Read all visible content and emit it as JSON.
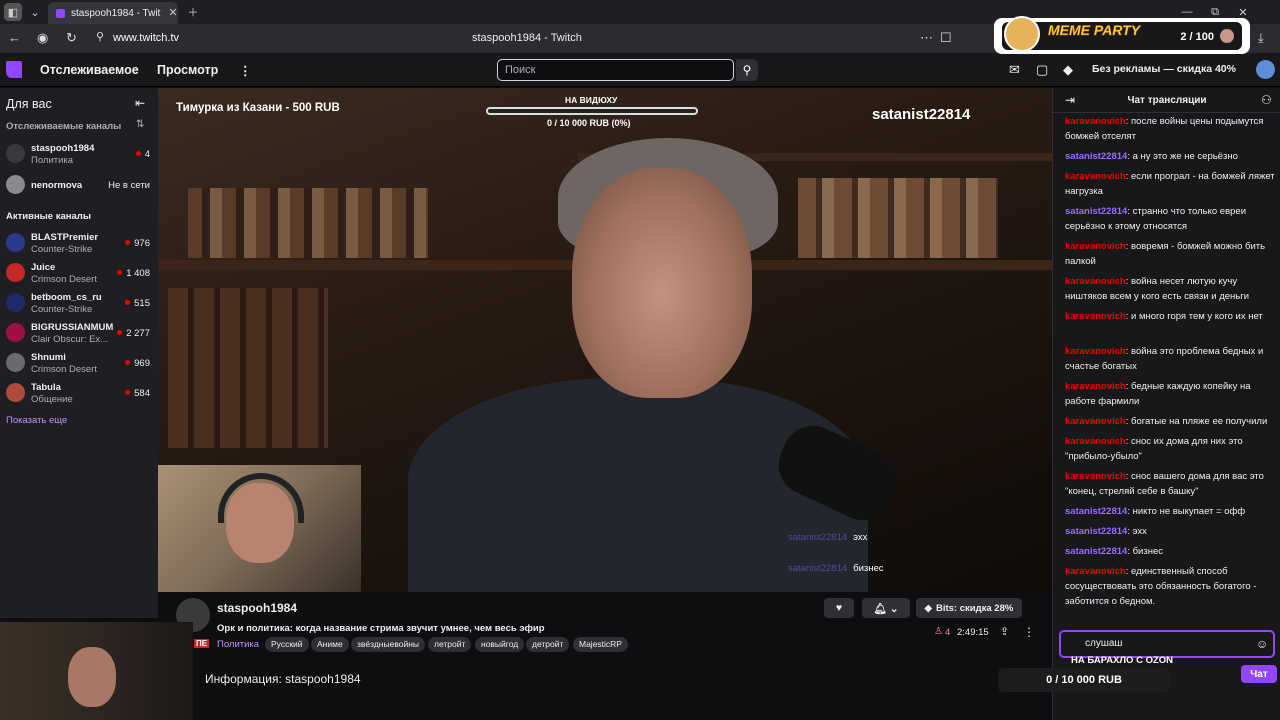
{
  "browser": {
    "tab_title": "staspooh1984 - Twit",
    "url": "www.twitch.tv",
    "page_title": "staspooh1984 - Twitch"
  },
  "topnav": {
    "following": "Отслеживаемое",
    "browse": "Просмотр",
    "search_placeholder": "Поиск",
    "promo": "Без рекламы — скидка 40%"
  },
  "sidebar": {
    "for_you": "Для вас",
    "followed_title": "Отслеживаемые каналы",
    "followed": [
      {
        "name": "staspooh1984",
        "game": "Политика",
        "viewers": "4",
        "color": "#3a3a3d"
      },
      {
        "name": "nenormova",
        "game": "",
        "status": "Не в сети",
        "color": "#8a8a8a"
      }
    ],
    "active_title": "Активные каналы",
    "active": [
      {
        "name": "BLASTPremier",
        "game": "Counter-Strike",
        "viewers": "976",
        "color": "#2b3a8a"
      },
      {
        "name": "Juice",
        "game": "Crimson Desert",
        "viewers": "1 408",
        "color": "#c62828"
      },
      {
        "name": "betboom_cs_ru",
        "game": "Counter-Strike",
        "viewers": "515",
        "color": "#1e2a6b"
      },
      {
        "name": "BIGRUSSIANMUM",
        "game": "Clair Obscur: Ex...",
        "viewers": "2 277",
        "color": "#a01040"
      },
      {
        "name": "Shnumi",
        "game": "Crimson Desert",
        "viewers": "969",
        "color": "#6b6b6b"
      },
      {
        "name": "Tabula",
        "game": "Общение",
        "viewers": "584",
        "color": "#b04a3a"
      }
    ],
    "show_more": "Показать еще"
  },
  "video": {
    "donation": "Тимурка из Казани - 500 RUB",
    "goal_title": "НА ВИДЮХУ",
    "goal_value": "0 / 10 000 RUB (0%)",
    "goal_progress": 0,
    "overlay_user": "satanist22814",
    "overlay_chat": [
      {
        "user": "satanist22814",
        "text": "эхх"
      },
      {
        "user": "satanist22814",
        "text": "бизнес"
      }
    ]
  },
  "stream": {
    "streamer": "staspooh1984",
    "title": "Орк и политика: когда название стрима звучит умнее, чем весь эфир",
    "badge": "ПЕ",
    "category": "Политика",
    "tags": [
      "Русский",
      "Аниме",
      "звёздныевойны",
      "летройт",
      "новыйгод",
      "детройт",
      "MajesticRP"
    ],
    "bits": "Bits: скидка 28%",
    "viewers": "4",
    "uptime": "2:49:15",
    "about": "Информация: staspooh1984"
  },
  "chat": {
    "title": "Чат трансляции",
    "messages": [
      {
        "user": "karavanovich",
        "text": "после войны цены подымутся бомжей отселят",
        "c": "u1"
      },
      {
        "user": "satanist22814",
        "text": "а ну это же не серьёзно",
        "c": "u2"
      },
      {
        "user": "karavanovich",
        "text": "если програл - на бомжей ляжет нагрузка",
        "c": "u1"
      },
      {
        "user": "satanist22814",
        "text": "странно что только евреи серьёзно к этому относятся",
        "c": "u2"
      },
      {
        "user": "karavanovich",
        "text": "вовремя - бомжей можно бить палкой",
        "c": "u1"
      },
      {
        "user": "karavanovich",
        "text": "война несет лютую кучу ништяков всем у кого есть связи и деньги",
        "c": "u1"
      },
      {
        "user": "karavanovich",
        "text": "и много горя тем у кого их нет",
        "c": "u1"
      },
      {
        "user": "karavanovich",
        "text": "война это проблема бедных и счастье богатых",
        "c": "u1"
      },
      {
        "user": "karavanovich",
        "text": "бедные каждую копейку на работе фармили",
        "c": "u1"
      },
      {
        "user": "karavanovich",
        "text": "богатые на пляже ее получили",
        "c": "u1"
      },
      {
        "user": "karavanovich",
        "text": "снос их дома для них это \"прибыло-убыло\"",
        "c": "u1"
      },
      {
        "user": "karavanovich",
        "text": "снос вашего дома для вас это \"конец, стреляй себе в башку\"",
        "c": "u1"
      },
      {
        "user": "satanist22814",
        "text": "никто не выкупает = офф",
        "c": "u2"
      },
      {
        "user": "satanist22814",
        "text": "эхх",
        "c": "u2"
      },
      {
        "user": "satanist22814",
        "text": "бизнес",
        "c": "u2"
      },
      {
        "user": "karavanovich",
        "text": "единственный способ сосуществовать это обязанность богатого - заботится о бедном.",
        "c": "u1"
      }
    ],
    "input_value": "слушаш",
    "ozon": "НА БАРАХЛО С OZON",
    "send": "Чат",
    "rub_goal": "0 / 10 000 RUB"
  },
  "meme_party": {
    "label": "MEME PARTY",
    "count": "2 / 100"
  }
}
